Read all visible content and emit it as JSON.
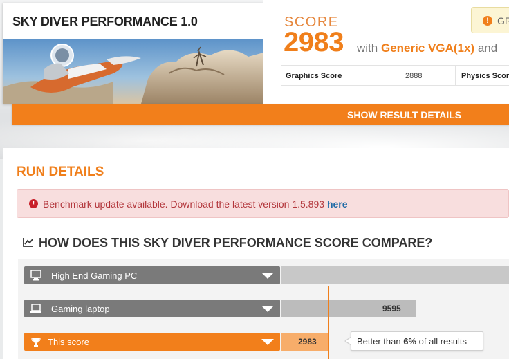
{
  "header": {
    "title": "SKY DIVER PERFORMANCE 1.0",
    "score_label": "SCORE",
    "score_value": "2983",
    "score_with": "with",
    "gpu_name": "Generic VGA(1x)",
    "score_and": "and",
    "badge_text": "GR",
    "subscores": {
      "graphics_label": "Graphics Score",
      "graphics_value": "2888",
      "physics_label": "Physics Score"
    },
    "show_details_label": "SHOW RESULT DETAILS"
  },
  "run_details": {
    "title": "RUN DETAILS",
    "alert": {
      "text": "Benchmark update available. Download the latest version 1.5.893",
      "link": "here"
    },
    "compare": {
      "title": "HOW DOES THIS SKY DIVER PERFORMANCE SCORE COMPARE?",
      "rows": [
        {
          "label": "High End Gaming PC",
          "value": "",
          "icon": "desktop-icon"
        },
        {
          "label": "Gaming laptop",
          "value": "9595",
          "icon": "laptop-icon"
        },
        {
          "label": "This score",
          "value": "2983",
          "icon": "trophy-icon"
        }
      ],
      "tooltip": {
        "prefix": "Better than",
        "percent": "6%",
        "suffix": "of all results"
      }
    }
  },
  "colors": {
    "accent": "#f27f1b",
    "alert_bg": "#f8dede",
    "alert_text": "#b3373c",
    "link": "#1e6aa6",
    "row_gray": "#7a7a7a",
    "bar_gray": "#bcbcbc"
  }
}
